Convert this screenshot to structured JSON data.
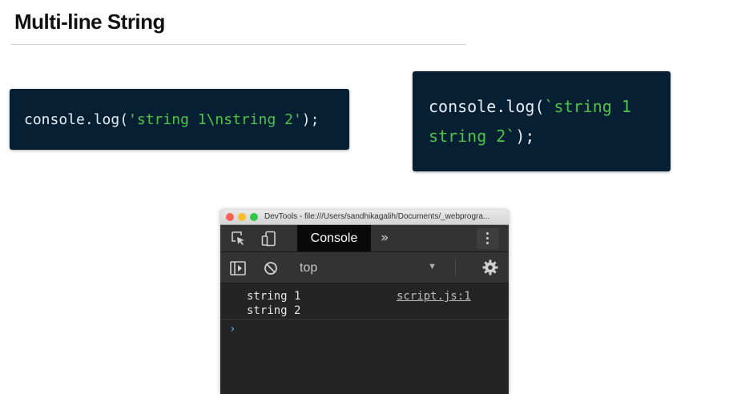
{
  "slide": {
    "title": "Multi-line String"
  },
  "code_examples": {
    "escape": {
      "prefix": "console.log(",
      "string": "'string 1\\nstring 2'",
      "suffix": ");"
    },
    "template": {
      "line1_prefix": "console.log(",
      "line1_string": "`string 1",
      "line2_string": "string 2`",
      "line2_suffix": ");"
    }
  },
  "devtools": {
    "window_title": "DevTools - file:///Users/sandhikagalih/Documents/_webprogra...",
    "tabs": {
      "active": "Console",
      "more": "»"
    },
    "filter": {
      "context": "top"
    },
    "log": {
      "line1": "string 1",
      "line2": "string 2",
      "source": "script.js:1"
    },
    "prompt": "›"
  },
  "colors": {
    "code_bg": "#061f33",
    "code_string": "#4cc44a",
    "devtools_bg": "#242424",
    "prompt_blue": "#4d9cf2"
  },
  "icons": [
    "inspect-element-icon",
    "device-toolbar-icon",
    "kebab-menu-icon",
    "sidebar-toggle-icon",
    "clear-console-icon",
    "dropdown-arrow-icon",
    "settings-gear-icon",
    "console-prompt-icon"
  ]
}
